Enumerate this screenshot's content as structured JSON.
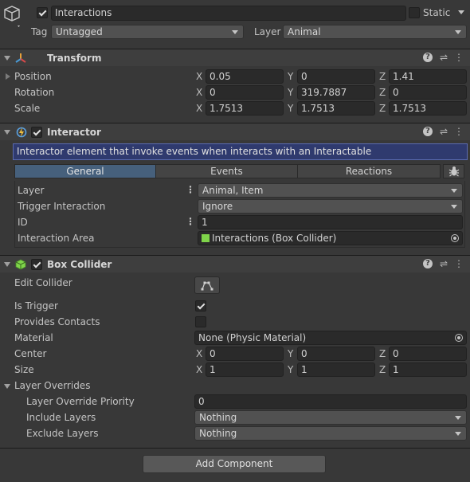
{
  "gameobject": {
    "name": "Interactions",
    "static_label": "Static",
    "tag_label": "Tag",
    "tag_value": "Untagged",
    "layer_label": "Layer",
    "layer_value": "Animal"
  },
  "transform": {
    "title": "Transform",
    "rows": [
      {
        "label": "Position",
        "x": "0.05",
        "y": "0",
        "z": "1.41"
      },
      {
        "label": "Rotation",
        "x": "0",
        "y": "319.7887",
        "z": "0"
      },
      {
        "label": "Scale",
        "x": "1.7513",
        "y": "1.7513",
        "z": "1.7513"
      }
    ],
    "axis_x": "X",
    "axis_y": "Y",
    "axis_z": "Z"
  },
  "interactor": {
    "title": "Interactor",
    "description": "Interactor element that invoke events when interacts with an Interactable",
    "tabs": [
      "General",
      "Events",
      "Reactions"
    ],
    "layer_label": "Layer",
    "layer_value": "Animal, Item",
    "trigger_label": "Trigger Interaction",
    "trigger_value": "Ignore",
    "id_label": "ID",
    "id_value": "1",
    "area_label": "Interaction Area",
    "area_value": "Interactions (Box Collider)"
  },
  "box_collider": {
    "title": "Box Collider",
    "edit_collider_label": "Edit Collider",
    "is_trigger_label": "Is Trigger",
    "provides_contacts_label": "Provides Contacts",
    "material_label": "Material",
    "material_value": "None (Physic Material)",
    "center_label": "Center",
    "center": {
      "x": "0",
      "y": "0",
      "z": "0"
    },
    "size_label": "Size",
    "size": {
      "x": "1",
      "y": "1",
      "z": "1"
    },
    "layer_overrides_label": "Layer Overrides",
    "override_priority_label": "Layer Override Priority",
    "override_priority_value": "0",
    "include_layers_label": "Include Layers",
    "include_layers_value": "Nothing",
    "exclude_layers_label": "Exclude Layers",
    "exclude_layers_value": "Nothing"
  },
  "add_component_label": "Add Component",
  "colors": {
    "background": "#383838",
    "header": "#3e3e3e",
    "help_box": "#2f3a6e",
    "tab_active": "#46607c"
  }
}
